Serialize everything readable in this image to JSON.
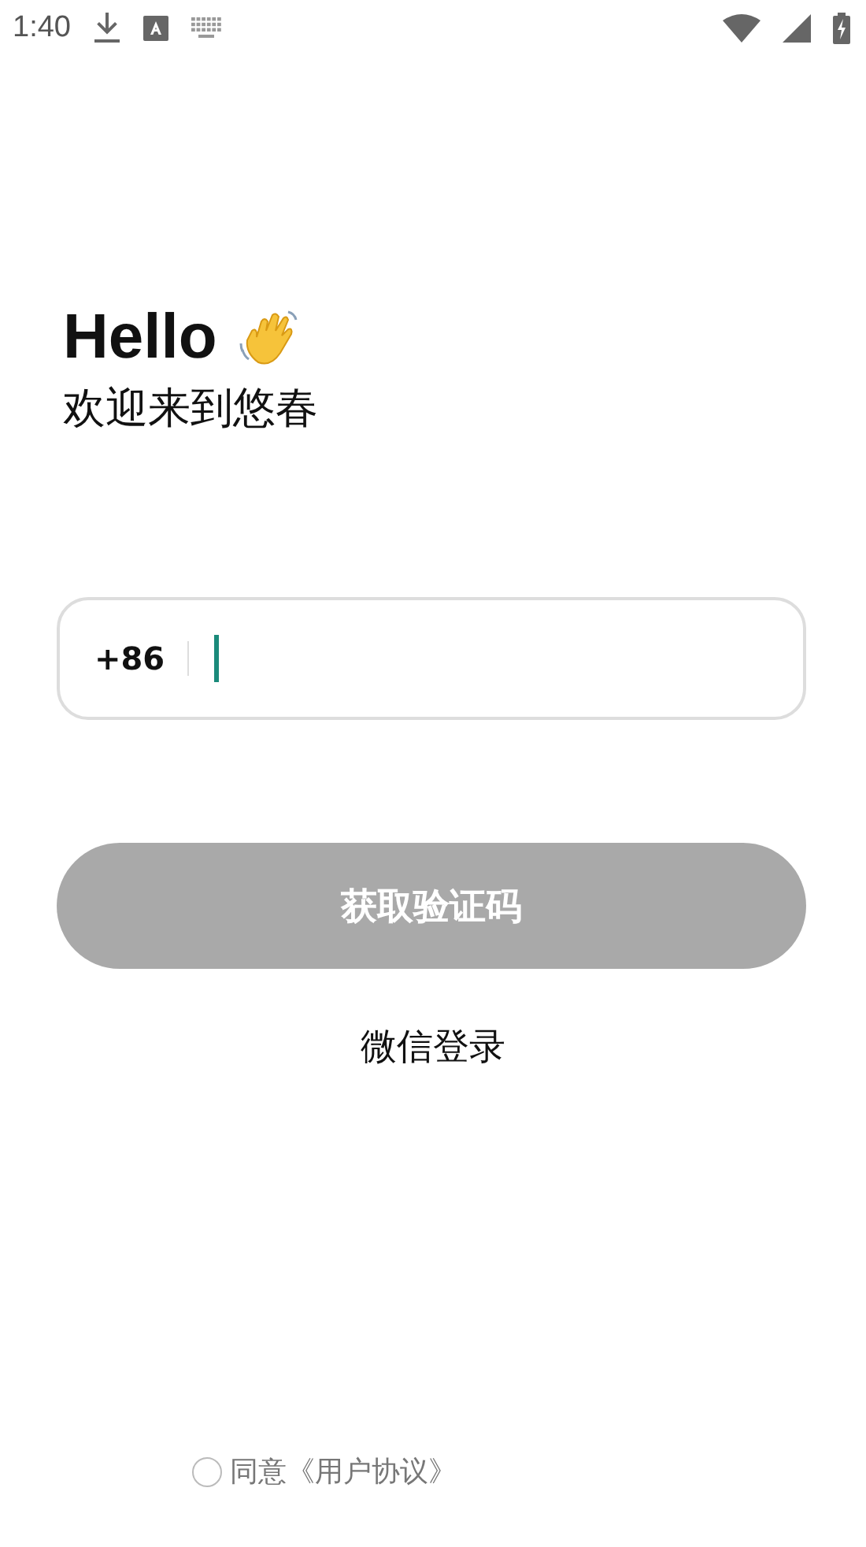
{
  "status_bar": {
    "time": "1:40"
  },
  "greeting": {
    "title": "Hello",
    "subtitle": "欢迎来到悠春"
  },
  "phone_field": {
    "country_code": "+86",
    "focused": true
  },
  "code_button": {
    "label": "获取验证码",
    "disabled": true
  },
  "wechat_login": {
    "label": "微信登录"
  },
  "agreement": {
    "checked": false,
    "text": "同意《用户协议》"
  }
}
